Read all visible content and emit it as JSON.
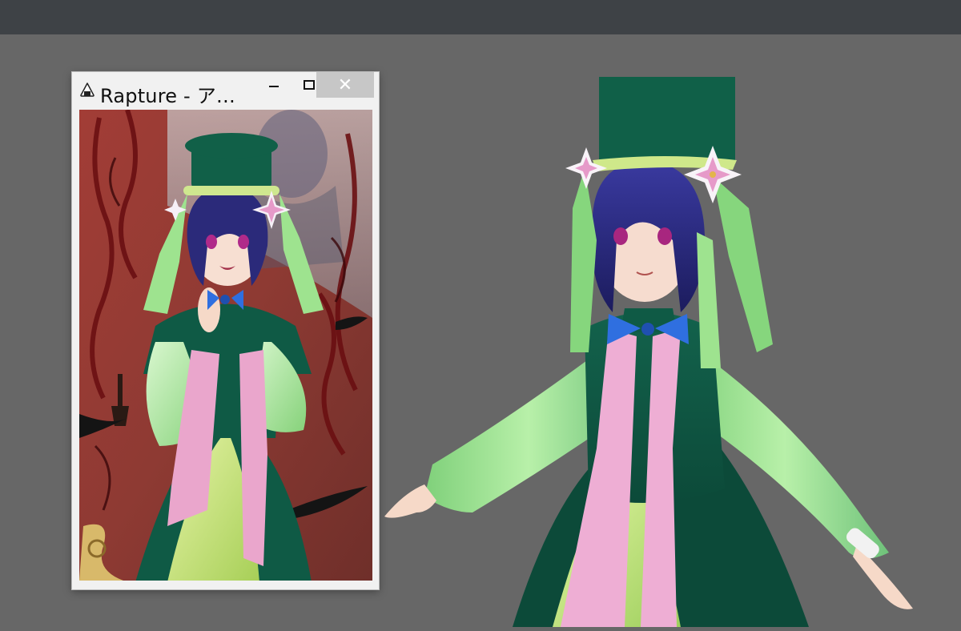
{
  "app": {
    "topbar_color": "#3e4246",
    "viewport_color": "#676767"
  },
  "window": {
    "title": "Rapture - ア…",
    "icon": "onigiri-icon",
    "buttons": {
      "minimize": "—",
      "maximize": "☐",
      "close": "✕"
    }
  },
  "artwork": {
    "subject": "character-illustration",
    "colors": {
      "background_red": "#8f3b34",
      "outfit_dark_green": "#0f5a45",
      "sleeve_light_green": "#a8e898",
      "sash_pink": "#eaa6cc",
      "hair_purple": "#2b2a7a",
      "bow_blue": "#2f6fe0"
    }
  },
  "model3d": {
    "subject": "3d-character-model"
  }
}
